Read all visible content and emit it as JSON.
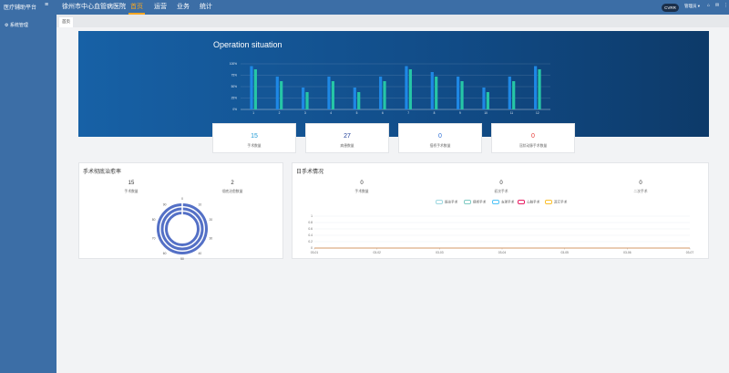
{
  "header": {
    "brand": "医疗辅助平台",
    "menu_toggle": "≡",
    "hospital": "徐州市中心血管病医院",
    "nav": [
      {
        "label": "首页",
        "active": true
      },
      {
        "label": "运营",
        "active": false
      },
      {
        "label": "业务",
        "active": false
      },
      {
        "label": "统计",
        "active": false
      }
    ],
    "badge": "CVRR",
    "user": "管理员 ▾"
  },
  "sidebar": {
    "item": "系统管理"
  },
  "tabs": [
    {
      "label": "首页"
    }
  ],
  "banner": {
    "title": "Operation situation"
  },
  "colors": {
    "bar_a": "#1e88e5",
    "bar_b": "#26c6a6",
    "donut": "#5470c6",
    "accent": "#f5a623"
  },
  "chart_data": [
    {
      "type": "bar",
      "title": "Operation situation",
      "categories": [
        "1",
        "2",
        "3",
        "4",
        "5",
        "6",
        "7",
        "8",
        "9",
        "10",
        "11",
        "12"
      ],
      "series": [
        {
          "values": [
            95,
            72,
            48,
            72,
            48,
            72,
            95,
            82,
            72,
            48,
            72,
            95
          ]
        },
        {
          "values": [
            88,
            62,
            38,
            62,
            38,
            62,
            88,
            72,
            62,
            38,
            62,
            88
          ]
        }
      ],
      "ytick_labels": [
        "0%",
        "25%",
        "50%",
        "75%",
        "100%"
      ],
      "ylim": [
        0,
        100
      ],
      "grid": true
    },
    {
      "type": "line",
      "x": [
        "03-01",
        "03-02",
        "03-03",
        "03-04",
        "03-05",
        "03-06",
        "03-07"
      ],
      "ylim": [
        0,
        1
      ],
      "yticks": [
        "0",
        "0.2",
        "0.4",
        "0.6",
        "0.8",
        "1"
      ],
      "series": [
        {
          "name": "既往手术",
          "values": [
            0,
            0,
            0,
            0,
            0,
            0,
            0
          ]
        },
        {
          "name": "搭桥手术",
          "values": [
            0,
            0,
            0,
            0,
            0,
            0,
            0
          ]
        },
        {
          "name": "支架手术",
          "values": [
            0,
            0,
            0,
            0,
            0,
            0,
            0
          ]
        },
        {
          "name": "心脏手术",
          "values": [
            0,
            0,
            0,
            0,
            0,
            0,
            0
          ]
        },
        {
          "name": "其它手术",
          "values": [
            0,
            0,
            0,
            0,
            0,
            0,
            0
          ]
        }
      ]
    }
  ],
  "cards": [
    {
      "num": "15",
      "label": "手术数量",
      "color": "#1e9ad6"
    },
    {
      "num": "27",
      "label": "病患数量",
      "color": "#1f3f99"
    },
    {
      "num": "0",
      "label": "搭桥手术数量",
      "color": "#2d6fd6"
    },
    {
      "num": "0",
      "label": "冠状动脉手术数量",
      "color": "#e53935"
    }
  ],
  "left_panel": {
    "title": "手术彻底治愈率",
    "stats": [
      {
        "num": "15",
        "label": "手术数量"
      },
      {
        "num": "2",
        "label": "彻底治愈数量"
      }
    ],
    "donut_ticks": [
      "0",
      "10",
      "20",
      "30",
      "40",
      "50",
      "60",
      "70",
      "80",
      "90"
    ]
  },
  "right_panel": {
    "title": "日手术情况",
    "stats": [
      {
        "num": "0",
        "label": "手术数量"
      },
      {
        "num": "0",
        "label": "初次手术"
      },
      {
        "num": "0",
        "label": "二次手术"
      }
    ],
    "legend_colors": [
      "#9fd8e0",
      "#80cbc4",
      "#4fc3f7",
      "#e91e63",
      "#fbc02d"
    ]
  }
}
